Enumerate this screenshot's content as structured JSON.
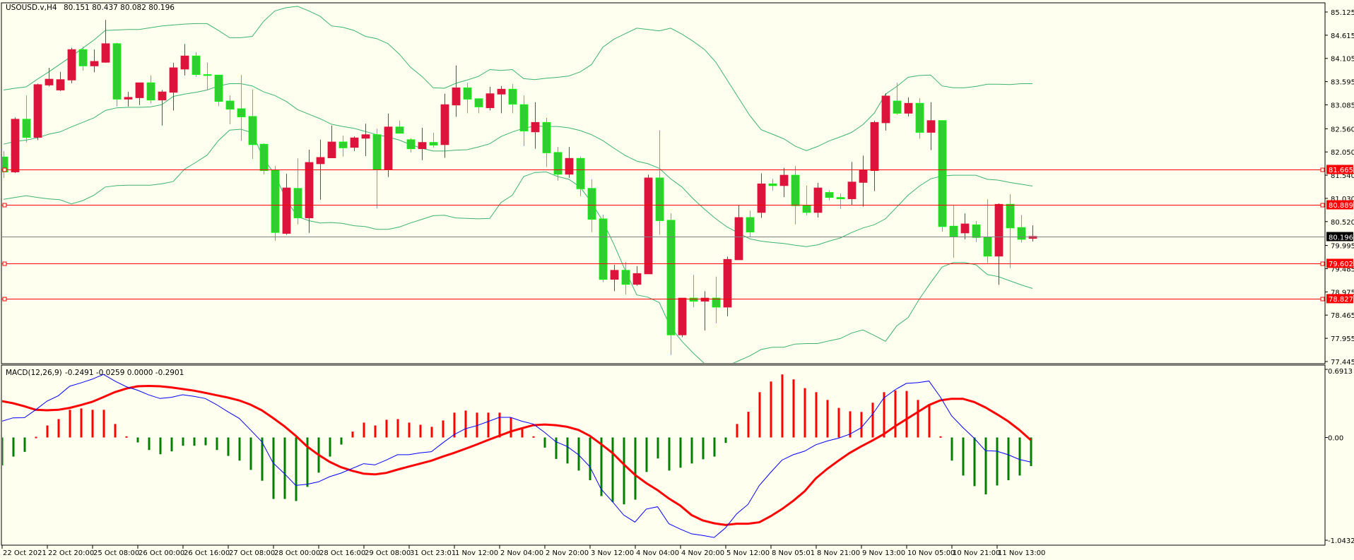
{
  "header": {
    "symbol": "USOUSD.v,H4",
    "ohlc_readout": "80.151 80.437 80.082 80.196"
  },
  "macd_header": {
    "label": "MACD(12,26,9)",
    "values_readout": "-0.2491 -0.0259 0.0000 -0.2901"
  },
  "colors": {
    "background": "#FFFFF0",
    "up_candle": "#DC143C",
    "down_candle": "#32CD32",
    "down_wick": "#00FF00",
    "bollinger": "#3CB371",
    "level_line": "#FF0000",
    "current_price_line": "#808080",
    "macd_line": "#0000FF",
    "signal_line": "#FF0000",
    "hist_positive": "#FF0000",
    "hist_negative": "#008000"
  },
  "chart_data": [
    {
      "type": "candlestick",
      "title": "USOUSD.v,H4",
      "timeframe": "H4",
      "ylim": [
        77.445,
        85.125
      ],
      "y_ticks": [
        "85.125",
        "84.615",
        "84.105",
        "83.595",
        "83.085",
        "82.560",
        "82.050",
        "81.540",
        "81.030",
        "80.520",
        "79.995",
        "79.485",
        "78.975",
        "78.465",
        "77.955",
        "77.445"
      ],
      "x_tick_labels": [
        "22 Oct 2021",
        "22 Oct 20:00",
        "25 Oct 08:00",
        "26 Oct 00:00",
        "26 Oct 16:00",
        "27 Oct 08:00",
        "28 Oct 00:00",
        "28 Oct 16:00",
        "29 Oct 08:00",
        "31 Oct 23:01",
        "1 Nov 12:00",
        "2 Nov 04:00",
        "2 Nov 20:00",
        "3 Nov 12:00",
        "4 Nov 04:00",
        "4 Nov 20:00",
        "5 Nov 12:00",
        "8 Nov 05:01",
        "8 Nov 21:00",
        "9 Nov 13:00",
        "10 Nov 05:00",
        "10 Nov 21:00",
        "11 Nov 13:00"
      ],
      "x_tick_every_bars": 4,
      "ohlc": [
        [
          81.94,
          82.07,
          81.48,
          81.61
        ],
        [
          81.61,
          82.81,
          81.59,
          82.77
        ],
        [
          82.77,
          83.29,
          82.26,
          82.37
        ],
        [
          82.37,
          83.55,
          82.31,
          83.53
        ],
        [
          83.52,
          83.9,
          83.49,
          83.65
        ],
        [
          83.41,
          83.81,
          83.39,
          83.64
        ],
        [
          83.63,
          84.34,
          83.56,
          84.3
        ],
        [
          84.3,
          84.36,
          83.84,
          83.94
        ],
        [
          83.94,
          84.3,
          83.8,
          84.04
        ],
        [
          84.02,
          84.95,
          84.01,
          84.43
        ],
        [
          84.43,
          84.45,
          83.05,
          83.21
        ],
        [
          83.21,
          83.37,
          83.05,
          83.25
        ],
        [
          83.24,
          83.57,
          83.08,
          83.57
        ],
        [
          83.57,
          83.73,
          83.12,
          83.19
        ],
        [
          83.19,
          83.41,
          82.63,
          83.37
        ],
        [
          83.36,
          84.01,
          82.96,
          83.9
        ],
        [
          83.87,
          84.42,
          83.73,
          84.16
        ],
        [
          84.16,
          84.24,
          83.7,
          83.75
        ],
        [
          83.75,
          84.01,
          83.41,
          83.73
        ],
        [
          83.74,
          83.74,
          83.06,
          83.16
        ],
        [
          83.17,
          83.29,
          82.66,
          82.99
        ],
        [
          83.0,
          83.74,
          82.3,
          82.82
        ],
        [
          82.83,
          83.42,
          81.9,
          82.21
        ],
        [
          82.22,
          82.24,
          81.56,
          81.64
        ],
        [
          81.65,
          81.74,
          80.1,
          80.28
        ],
        [
          80.26,
          81.57,
          80.23,
          81.26
        ],
        [
          81.25,
          81.91,
          80.46,
          80.6
        ],
        [
          80.6,
          82.1,
          80.27,
          81.82
        ],
        [
          81.79,
          82.32,
          81.0,
          81.93
        ],
        [
          81.92,
          82.63,
          81.92,
          82.27
        ],
        [
          82.27,
          82.41,
          81.95,
          82.14
        ],
        [
          82.15,
          82.39,
          82.07,
          82.36
        ],
        [
          82.35,
          82.67,
          81.96,
          82.43
        ],
        [
          82.43,
          82.56,
          80.81,
          81.66
        ],
        [
          81.66,
          82.89,
          81.5,
          82.6
        ],
        [
          82.6,
          82.74,
          82.46,
          82.46
        ],
        [
          82.32,
          82.35,
          82.04,
          82.12
        ],
        [
          82.12,
          82.58,
          81.87,
          82.26
        ],
        [
          82.26,
          82.47,
          82.15,
          82.2
        ],
        [
          82.21,
          83.33,
          81.92,
          83.09
        ],
        [
          83.08,
          83.95,
          82.82,
          83.46
        ],
        [
          83.46,
          83.57,
          82.9,
          83.21
        ],
        [
          83.22,
          83.22,
          82.9,
          83.04
        ],
        [
          83.02,
          83.48,
          82.96,
          83.33
        ],
        [
          83.32,
          83.5,
          82.9,
          83.43
        ],
        [
          83.43,
          83.54,
          82.9,
          83.1
        ],
        [
          83.09,
          83.29,
          82.18,
          82.51
        ],
        [
          82.49,
          83.14,
          82.12,
          82.7
        ],
        [
          82.7,
          82.8,
          81.72,
          82.03
        ],
        [
          82.04,
          82.16,
          81.42,
          81.56
        ],
        [
          81.56,
          82.16,
          81.48,
          81.91
        ],
        [
          81.91,
          81.95,
          81.08,
          81.24
        ],
        [
          81.25,
          81.45,
          80.29,
          80.57
        ],
        [
          80.58,
          80.67,
          79.19,
          79.25
        ],
        [
          79.25,
          79.57,
          78.99,
          79.45
        ],
        [
          79.45,
          79.63,
          78.92,
          79.14
        ],
        [
          79.14,
          79.54,
          79.11,
          79.38
        ],
        [
          79.37,
          81.55,
          79.37,
          81.48
        ],
        [
          81.48,
          82.52,
          80.23,
          80.54
        ],
        [
          80.55,
          80.7,
          77.59,
          78.03
        ],
        [
          78.03,
          78.84,
          77.98,
          78.84
        ],
        [
          78.84,
          79.35,
          78.64,
          78.77
        ],
        [
          78.77,
          78.99,
          78.13,
          78.84
        ],
        [
          78.84,
          79.31,
          78.29,
          78.64
        ],
        [
          78.64,
          79.75,
          78.44,
          79.69
        ],
        [
          79.68,
          80.88,
          79.68,
          80.61
        ],
        [
          80.61,
          80.76,
          80.19,
          80.29
        ],
        [
          80.72,
          81.58,
          80.6,
          81.35
        ],
        [
          81.35,
          81.46,
          81.2,
          81.31
        ],
        [
          81.31,
          81.7,
          81.06,
          81.54
        ],
        [
          81.54,
          81.74,
          80.46,
          80.87
        ],
        [
          80.87,
          81.31,
          80.66,
          80.72
        ],
        [
          80.72,
          81.37,
          80.61,
          81.26
        ],
        [
          81.16,
          81.21,
          80.99,
          81.05
        ],
        [
          81.05,
          81.14,
          80.8,
          81.02
        ],
        [
          81.02,
          81.83,
          80.89,
          81.39
        ],
        [
          81.38,
          81.97,
          80.85,
          81.66
        ],
        [
          81.64,
          82.74,
          81.19,
          82.7
        ],
        [
          82.69,
          83.34,
          82.52,
          83.28
        ],
        [
          83.17,
          83.57,
          82.87,
          82.9
        ],
        [
          82.9,
          83.25,
          82.83,
          83.12
        ],
        [
          83.12,
          83.23,
          82.34,
          82.48
        ],
        [
          82.48,
          83.14,
          82.09,
          82.74
        ],
        [
          82.74,
          82.75,
          80.3,
          80.41
        ],
        [
          80.42,
          80.88,
          79.73,
          80.19
        ],
        [
          80.27,
          80.7,
          80.13,
          80.47
        ],
        [
          80.45,
          80.53,
          80.07,
          80.17
        ],
        [
          80.18,
          81.01,
          79.61,
          79.76
        ],
        [
          79.76,
          80.92,
          79.13,
          80.9
        ],
        [
          80.9,
          81.12,
          79.5,
          80.38
        ],
        [
          80.39,
          80.66,
          80.06,
          80.13
        ],
        [
          80.151,
          80.437,
          80.082,
          80.196
        ]
      ],
      "bollinger": {
        "upper": [
          83.41,
          83.45,
          83.48,
          83.65,
          83.81,
          83.98,
          84.15,
          84.33,
          84.51,
          84.72,
          84.73,
          84.74,
          84.74,
          84.78,
          84.82,
          84.84,
          84.86,
          84.87,
          84.87,
          84.72,
          84.56,
          84.56,
          84.59,
          84.92,
          85.15,
          85.22,
          85.25,
          85.15,
          85.03,
          84.82,
          84.79,
          84.72,
          84.59,
          84.54,
          84.43,
          84.2,
          83.91,
          83.71,
          83.46,
          83.45,
          83.56,
          83.63,
          83.71,
          83.86,
          83.84,
          83.86,
          83.66,
          83.64,
          83.67,
          83.69,
          83.72,
          83.81,
          83.97,
          84.35,
          84.53,
          84.65,
          84.77,
          84.74,
          84.71,
          84.77,
          84.64,
          84.48,
          84.3,
          84.02,
          83.63,
          83.24,
          82.85,
          82.54,
          82.44,
          82.34,
          82.18,
          82.08,
          82.17,
          82.29,
          82.38,
          82.48,
          82.65,
          82.9,
          83.32,
          83.49,
          83.69,
          83.73,
          83.74,
          83.5,
          83.46,
          83.46,
          83.49,
          83.54,
          83.54,
          83.53,
          83.55,
          83.55
        ],
        "middle": [
          82.22,
          82.28,
          82.31,
          82.36,
          82.44,
          82.49,
          82.6,
          82.7,
          82.8,
          82.96,
          83.02,
          83.03,
          83.03,
          83.04,
          83.09,
          83.27,
          83.32,
          83.36,
          83.41,
          83.5,
          83.55,
          83.55,
          83.5,
          83.37,
          83.29,
          83.16,
          82.98,
          82.88,
          82.78,
          82.66,
          82.61,
          82.57,
          82.5,
          82.43,
          82.38,
          82.31,
          82.21,
          82.13,
          82.07,
          82.07,
          82.09,
          82.1,
          82.16,
          82.23,
          82.39,
          82.49,
          82.57,
          82.62,
          82.61,
          82.61,
          82.58,
          82.52,
          82.43,
          82.3,
          82.13,
          81.97,
          81.85,
          81.79,
          81.69,
          81.46,
          81.28,
          81.02,
          80.79,
          80.58,
          80.4,
          80.27,
          80.14,
          80.09,
          80.06,
          80.04,
          80.0,
          79.97,
          80.01,
          80.09,
          80.16,
          80.28,
          80.38,
          80.45,
          80.58,
          80.84,
          81.1,
          81.3,
          81.46,
          81.52,
          81.54,
          81.54,
          81.54,
          81.45,
          81.43,
          81.38,
          81.34,
          81.3
        ],
        "lower": [
          81.01,
          81.05,
          81.09,
          81.05,
          81.02,
          81.0,
          80.91,
          80.98,
          81.1,
          81.28,
          81.31,
          81.32,
          81.32,
          81.32,
          81.35,
          81.4,
          81.67,
          81.82,
          81.98,
          82.3,
          82.53,
          82.55,
          82.47,
          81.9,
          81.56,
          81.0,
          80.63,
          80.54,
          80.49,
          80.5,
          80.48,
          80.43,
          80.41,
          80.35,
          80.35,
          80.4,
          80.49,
          80.57,
          80.65,
          80.66,
          80.6,
          80.59,
          80.58,
          80.59,
          80.94,
          81.1,
          81.51,
          81.6,
          81.61,
          81.51,
          81.45,
          81.28,
          80.94,
          80.53,
          80.01,
          79.44,
          78.91,
          78.86,
          78.74,
          78.2,
          77.89,
          77.63,
          77.4,
          77.32,
          77.35,
          77.46,
          77.57,
          77.71,
          77.76,
          77.76,
          77.83,
          77.84,
          77.84,
          77.9,
          77.95,
          78.07,
          78.14,
          78.02,
          77.89,
          78.23,
          78.41,
          78.82,
          79.18,
          79.52,
          79.62,
          79.62,
          79.57,
          79.36,
          79.31,
          79.22,
          79.13,
          79.05
        ]
      },
      "horizontal_levels": [
        "81.665",
        "80.889",
        "79.602",
        "78.827"
      ],
      "current_price": "80.196"
    },
    {
      "type": "macd",
      "title": "MACD(12,26,9)",
      "ylim": [
        -1.0432,
        0.6913
      ],
      "y_ticks": [
        "0.6913",
        "0.00",
        "-1.0432"
      ],
      "macd": [
        0.165,
        0.199,
        0.201,
        0.281,
        0.369,
        0.424,
        0.52,
        0.554,
        0.592,
        0.64,
        0.573,
        0.516,
        0.48,
        0.432,
        0.396,
        0.408,
        0.434,
        0.417,
        0.396,
        0.333,
        0.261,
        0.194,
        0.077,
        -0.043,
        -0.259,
        -0.367,
        -0.487,
        -0.475,
        -0.451,
        -0.398,
        -0.362,
        -0.314,
        -0.266,
        -0.278,
        -0.23,
        -0.175,
        -0.175,
        -0.156,
        -0.144,
        -0.055,
        0.029,
        0.089,
        0.12,
        0.161,
        0.204,
        0.204,
        0.165,
        0.137,
        0.053,
        -0.043,
        -0.091,
        -0.175,
        -0.295,
        -0.523,
        -0.65,
        -0.787,
        -0.859,
        -0.727,
        -0.703,
        -0.875,
        -0.93,
        -0.978,
        -0.995,
        -1.015,
        -0.918,
        -0.775,
        -0.679,
        -0.487,
        -0.355,
        -0.23,
        -0.175,
        -0.139,
        -0.074,
        -0.036,
        -0.007,
        0.034,
        0.098,
        0.233,
        0.4,
        0.484,
        0.549,
        0.556,
        0.573,
        0.412,
        0.221,
        0.101,
        -0.007,
        -0.134,
        -0.139,
        -0.175,
        -0.223,
        -0.2491
      ],
      "signal": [
        0.369,
        0.348,
        0.317,
        0.281,
        0.276,
        0.281,
        0.3,
        0.329,
        0.362,
        0.41,
        0.46,
        0.496,
        0.52,
        0.523,
        0.52,
        0.508,
        0.492,
        0.475,
        0.453,
        0.429,
        0.405,
        0.376,
        0.333,
        0.276,
        0.197,
        0.113,
        0.017,
        -0.091,
        -0.175,
        -0.247,
        -0.302,
        -0.338,
        -0.367,
        -0.374,
        -0.36,
        -0.326,
        -0.295,
        -0.266,
        -0.235,
        -0.194,
        -0.156,
        -0.115,
        -0.072,
        -0.026,
        0.017,
        0.06,
        0.094,
        0.125,
        0.132,
        0.125,
        0.108,
        0.077,
        0.017,
        -0.067,
        -0.156,
        -0.271,
        -0.379,
        -0.463,
        -0.535,
        -0.619,
        -0.691,
        -0.787,
        -0.842,
        -0.871,
        -0.888,
        -0.875,
        -0.875,
        -0.861,
        -0.799,
        -0.727,
        -0.643,
        -0.547,
        -0.415,
        -0.319,
        -0.235,
        -0.156,
        -0.091,
        -0.031,
        0.034,
        0.113,
        0.185,
        0.257,
        0.329,
        0.376,
        0.393,
        0.393,
        0.36,
        0.305,
        0.237,
        0.165,
        0.077,
        -0.0259
      ],
      "histogram": [
        -0.283,
        -0.194,
        -0.146,
        0.007,
        0.122,
        0.187,
        0.281,
        0.295,
        0.281,
        0.281,
        0.137,
        0.012,
        -0.05,
        -0.127,
        -0.17,
        -0.141,
        -0.084,
        -0.084,
        -0.079,
        -0.127,
        -0.187,
        -0.235,
        -0.329,
        -0.439,
        -0.624,
        -0.624,
        -0.645,
        -0.501,
        -0.357,
        -0.194,
        -0.072,
        0.06,
        0.151,
        0.122,
        0.18,
        0.187,
        0.151,
        0.129,
        0.108,
        0.173,
        0.252,
        0.273,
        0.252,
        0.252,
        0.252,
        0.201,
        0.094,
        0.012,
        -0.103,
        -0.218,
        -0.264,
        -0.336,
        -0.434,
        -0.595,
        -0.655,
        -0.679,
        -0.631,
        -0.35,
        -0.213,
        -0.336,
        -0.307,
        -0.264,
        -0.221,
        -0.194,
        -0.055,
        0.137,
        0.261,
        0.46,
        0.568,
        0.64,
        0.59,
        0.501,
        0.46,
        0.381,
        0.3,
        0.266,
        0.259,
        0.353,
        0.46,
        0.477,
        0.472,
        0.381,
        0.329,
        0.012,
        -0.235,
        -0.386,
        -0.494,
        -0.578,
        -0.487,
        -0.434,
        -0.386,
        -0.2901
      ]
    }
  ]
}
